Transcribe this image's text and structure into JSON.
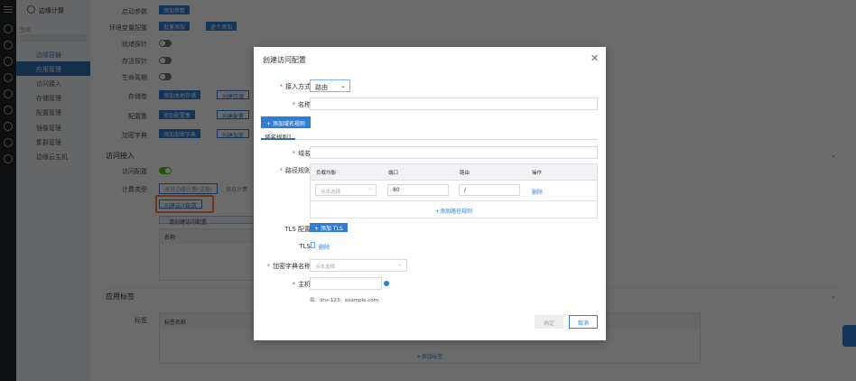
{
  "sidebar": {
    "brand": "边缘计算",
    "space_label": "空间",
    "groups": [
      {
        "label": "边缘容器",
        "items": [
          "应用管理",
          "访问接入",
          "存储管理",
          "配置管理",
          "镜像管理",
          "集群管理"
        ]
      },
      {
        "label": "边缘云主机"
      }
    ]
  },
  "form": {
    "rows": [
      {
        "label": "启动参数",
        "buttons": [
          "添加参数"
        ]
      },
      {
        "label": "环境变量配置",
        "buttons": [
          "批量添加",
          "逐个添加"
        ]
      },
      {
        "label": "就绪探针"
      },
      {
        "label": "存活探针"
      },
      {
        "label": "生命周期"
      },
      {
        "label": "存储卷",
        "buttons": [
          "添加本地存储",
          "创建存储"
        ]
      },
      {
        "label": "配置集",
        "buttons": [
          "添加配置集",
          "创建配置"
        ]
      },
      {
        "label": "加密字典",
        "buttons": [
          "添加加密字典",
          "创建加密"
        ]
      }
    ],
    "access": {
      "title": "访问接入",
      "config_label": "访问配置",
      "billing_label": "计费类型",
      "billing_options": [
        "按月边缘计费(试用)",
        "按日计费"
      ],
      "create_button": "创建访问配置",
      "info": "请创建访问配置",
      "table_header": "名称"
    },
    "tags": {
      "title": "应用标签",
      "label": "标签",
      "table_header": "标签名称",
      "add_link": "+添加标签"
    }
  },
  "modal": {
    "title": "创建访问配置",
    "access_mode_label": "接入方式",
    "access_mode_value": "路由",
    "name_label": "名称",
    "name_value": "",
    "add_domain_rule": "+ 添加域名规则",
    "tab": "域名规则1",
    "domain_label": "域名",
    "domain_value": "",
    "path_rules_label": "路径规则",
    "columns": [
      "负载均衡",
      "端口",
      "路由",
      "操作"
    ],
    "rows": [
      {
        "lb_placeholder": "点击选择",
        "port": "80",
        "route": "/",
        "action": "删除"
      }
    ],
    "add_path_rule": "+添加路径规则",
    "tls_config_label": "TLS 配置",
    "add_tls": "+ 添加 TLS",
    "tls_label": "TLS",
    "tls_delete": "删除",
    "secret_label": "加密字典名称",
    "secret_placeholder": "点击选择",
    "host_label": "主机",
    "host_value": "",
    "host_hint": "如：dns-123、example.com",
    "confirm": "确定",
    "cancel": "取消"
  },
  "colors": {
    "primary": "#2d7fd6",
    "required": "#e84a3a",
    "highlight": "#e8412c"
  }
}
